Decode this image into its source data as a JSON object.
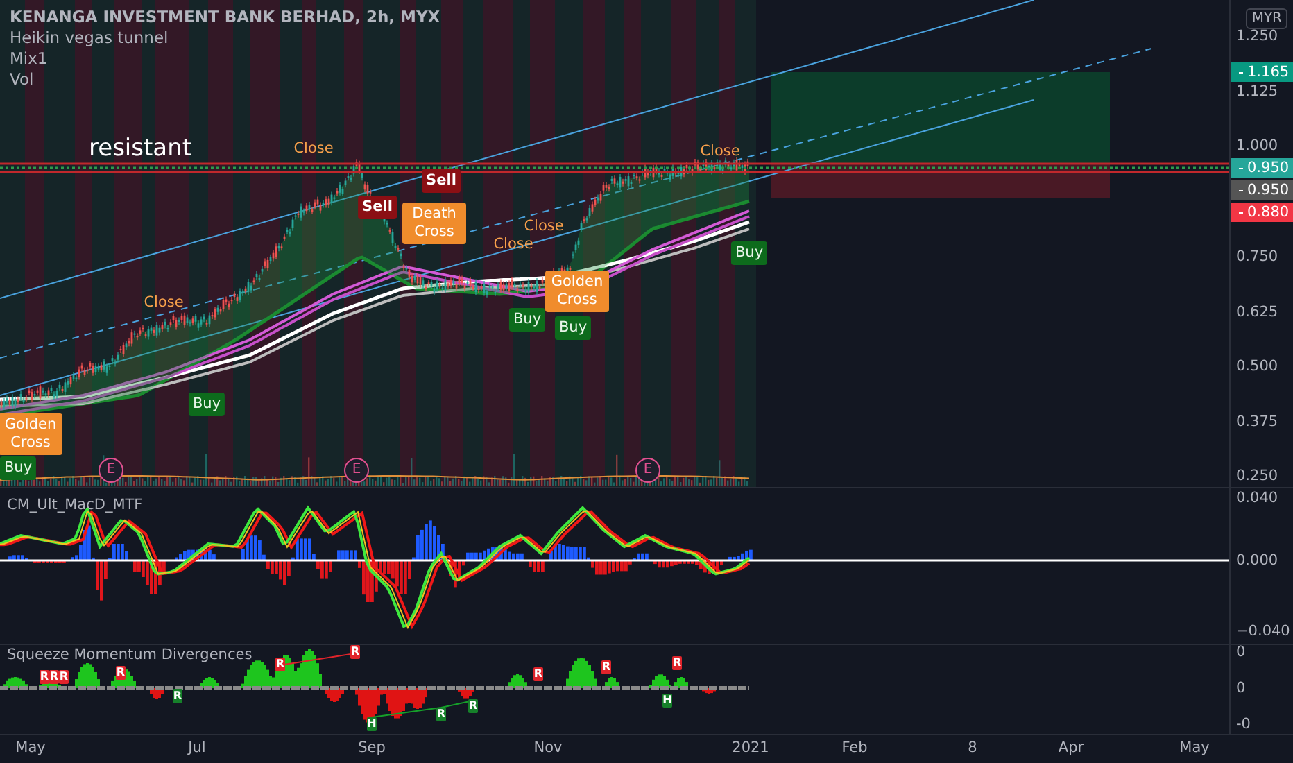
{
  "header": {
    "title": "KENANGA INVESTMENT BANK BERHAD, 2h, MYX",
    "indicators": [
      "Heikin vegas tunnel",
      "Mix1",
      "Vol"
    ]
  },
  "annotation": "resistant",
  "signals": [
    {
      "kind": "close",
      "text": "Close"
    },
    {
      "kind": "sell",
      "text": "Sell"
    },
    {
      "kind": "sell",
      "text": "Sell"
    },
    {
      "kind": "close",
      "text": "Close"
    },
    {
      "kind": "cross",
      "text": "Death Cross"
    },
    {
      "kind": "close",
      "text": "Close"
    },
    {
      "kind": "close",
      "text": "Close"
    },
    {
      "kind": "cross",
      "text": "Golden Cross"
    },
    {
      "kind": "buy",
      "text": "Buy"
    },
    {
      "kind": "buy",
      "text": "Buy"
    },
    {
      "kind": "close",
      "text": "Close"
    },
    {
      "kind": "buy",
      "text": "Buy"
    },
    {
      "kind": "buy",
      "text": "Buy"
    },
    {
      "kind": "cross",
      "text": "Golden Cross"
    },
    {
      "kind": "buy",
      "text": "Buy"
    }
  ],
  "earnings_markers": [
    "E",
    "E",
    "E"
  ],
  "price_axis": {
    "currency": "MYR",
    "ticks": [
      "1.250",
      "1.125",
      "1.000",
      "0.750",
      "0.625",
      "0.500",
      "0.375",
      "0.250"
    ],
    "badges": [
      {
        "text": "1.165",
        "color": "#089981"
      },
      {
        "text": "0.950",
        "color": "#26a69a"
      },
      {
        "text": "0.950",
        "color": "#555555"
      },
      {
        "text": "0.880",
        "color": "#f23645"
      }
    ]
  },
  "macd_pane": {
    "title": "CM_Ult_MacD_MTF",
    "ticks": [
      "0.040",
      "0.000",
      "−0.040"
    ]
  },
  "squeeze_pane": {
    "title": "Squeeze Momentum Divergences",
    "ticks": [
      "0",
      "0",
      "-0"
    ],
    "markers": [
      {
        "kind": "bear",
        "text": "R"
      },
      {
        "kind": "bear",
        "text": "R"
      },
      {
        "kind": "bear",
        "text": "R"
      },
      {
        "kind": "bear",
        "text": "R"
      },
      {
        "kind": "bear",
        "text": "R"
      },
      {
        "kind": "bear",
        "text": "R"
      },
      {
        "kind": "bear",
        "text": "R"
      },
      {
        "kind": "bear",
        "text": "R"
      },
      {
        "kind": "bear",
        "text": "R"
      },
      {
        "kind": "bull",
        "text": "R"
      },
      {
        "kind": "bull",
        "text": "H"
      },
      {
        "kind": "bull",
        "text": "R"
      },
      {
        "kind": "bull",
        "text": "R"
      },
      {
        "kind": "bull",
        "text": "H"
      }
    ]
  },
  "time_axis": [
    "May",
    "Jul",
    "Sep",
    "Nov",
    "2021",
    "Feb",
    "8",
    "Apr",
    "May"
  ]
}
